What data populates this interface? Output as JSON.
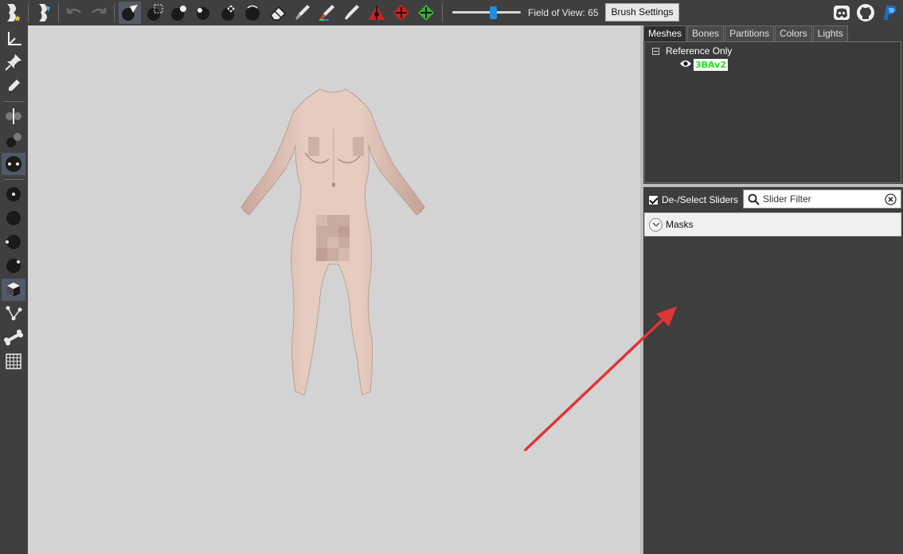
{
  "toolbar": {
    "field_of_view_label": "Field of View: 65",
    "field_of_view_value": 65,
    "field_of_view_range": [
      10,
      100
    ],
    "brush_settings_label": "Brush Settings"
  },
  "tabs": [
    {
      "label": "Meshes",
      "active": true
    },
    {
      "label": "Bones",
      "active": false
    },
    {
      "label": "Partitions",
      "active": false
    },
    {
      "label": "Colors",
      "active": false
    },
    {
      "label": "Lights",
      "active": false
    }
  ],
  "mesh_tree": {
    "group_label": "Reference Only",
    "meshes": [
      {
        "name": "3BAv2",
        "visible": true
      }
    ]
  },
  "slider_panel": {
    "deselect_label": "De-/Select Sliders",
    "deselect_checked": true,
    "filter_placeholder": "Slider Filter",
    "masks_label": "Masks"
  },
  "colors": {
    "accent": "#1f8ee0",
    "mesh_name": "#1fe61f",
    "annotation_arrow": "#e03535",
    "viewport_bg": "#d3d3d3",
    "panel_bg": "#3e3e3e"
  }
}
